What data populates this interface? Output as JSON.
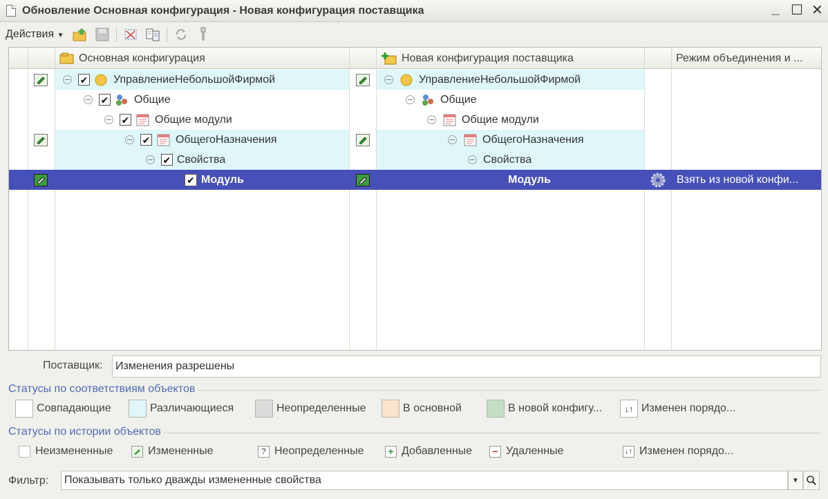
{
  "window": {
    "title": "Обновление Основная конфигурация - Новая конфигурация поставщика",
    "buttons": {
      "minimize": "_",
      "maximize": "☐",
      "close": "✕"
    }
  },
  "toolbar": {
    "actions_label": "Действия",
    "icons": [
      "upload-icon",
      "save-icon",
      "select-icon",
      "compare-icon",
      "refresh-icon",
      "settings-icon"
    ]
  },
  "grid": {
    "columns": {
      "main": "Основная конфигурация",
      "vendor": "Новая конфигурация поставщика",
      "mode": "Режим объединения и ..."
    },
    "rows": [
      {
        "main": "УправлениеНебольшойФирмой",
        "vendor": "УправлениеНебольшойФирмой",
        "mode": "",
        "changed": true
      },
      {
        "main": "Общие",
        "vendor": "Общие",
        "mode": "",
        "changed": false
      },
      {
        "main": "Общие модули",
        "vendor": "Общие модули",
        "mode": "",
        "changed": false
      },
      {
        "main": "ОбщегоНазначения",
        "vendor": "ОбщегоНазначения",
        "mode": "",
        "changed": true
      },
      {
        "main": "Свойства",
        "vendor": "Свойства",
        "mode": "",
        "changed": false
      },
      {
        "main": "Модуль",
        "vendor": "Модуль",
        "mode": "Взять из новой конфи...",
        "changed": true
      }
    ]
  },
  "supplier": {
    "label": "Поставщик:",
    "value": "Изменения разрешены"
  },
  "match_status": {
    "title": "Статусы по соответствиям объектов",
    "items": [
      {
        "label": "Совпадающие",
        "color": "#ffffff"
      },
      {
        "label": "Различающиеся",
        "color": "#dff7f9"
      },
      {
        "label": "Неопределенные",
        "color": "#dcdcda"
      },
      {
        "label": "В основной",
        "color": "#fbe3cb"
      },
      {
        "label": "В новой конфигу...",
        "color": "#c4dec4"
      },
      {
        "label": "Изменен порядо..."
      }
    ]
  },
  "history_status": {
    "title": "Статусы по истории объектов",
    "items": [
      {
        "label": "Неизмененные"
      },
      {
        "label": "Измененные"
      },
      {
        "label": "Неопределенные",
        "icon_text": "?"
      },
      {
        "label": "Добавленные",
        "icon_text": "+"
      },
      {
        "label": "Удаленные",
        "icon_text": "−"
      },
      {
        "label": "Изменен порядо..."
      }
    ]
  },
  "filter": {
    "label": "Фильтр:",
    "value": "Показывать только дважды измененные свойства"
  }
}
